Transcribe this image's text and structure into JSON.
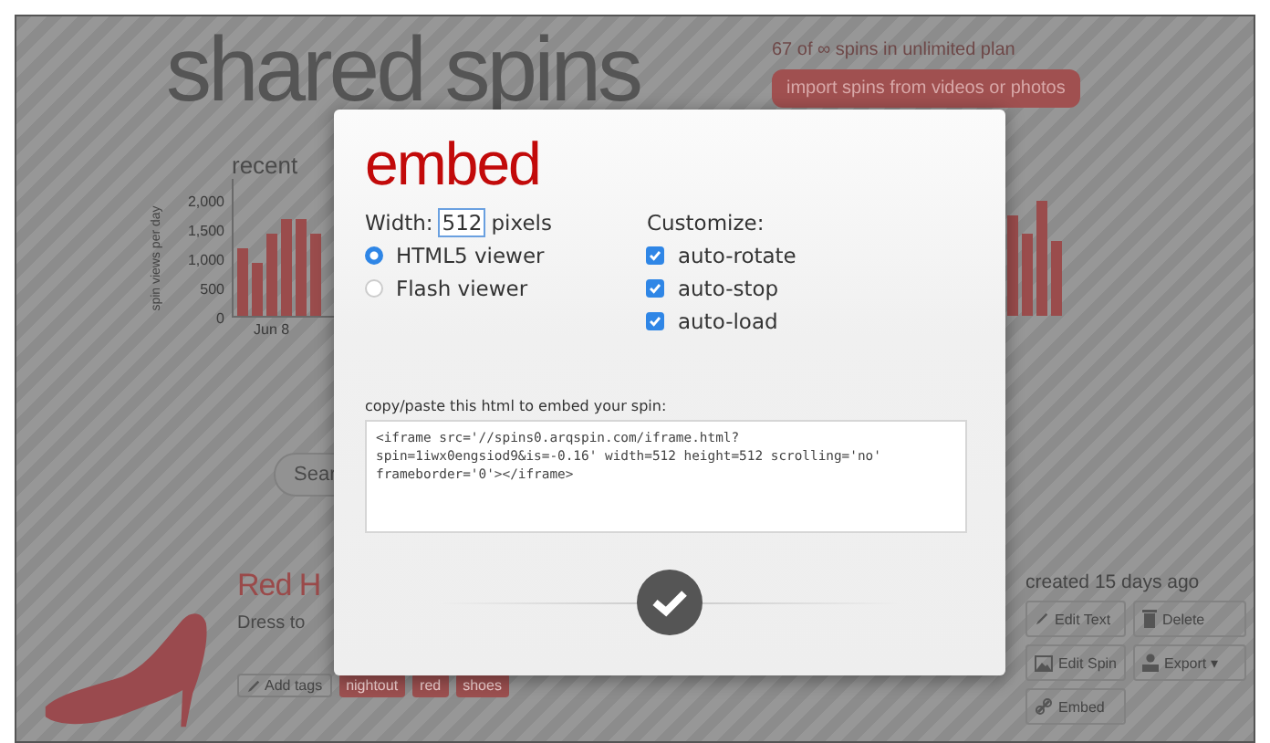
{
  "page": {
    "title": "shared spins",
    "plan_text": "67 of ∞ spins in unlimited plan",
    "import_button": "import spins from videos or photos",
    "chart": {
      "heading": "recent",
      "ylabel": "spin views per day",
      "yticks": [
        "2,000",
        "1,500",
        "1,000",
        "500",
        "0"
      ],
      "xtick": "Jun 8"
    },
    "search": {
      "placeholder": "Sear"
    },
    "spin": {
      "title": "Red H",
      "description": "Dress to",
      "tags": [
        {
          "label": "Add tags",
          "kind": "add"
        },
        {
          "label": "nightout",
          "kind": "tag"
        },
        {
          "label": "red",
          "kind": "tag"
        },
        {
          "label": "shoes",
          "kind": "tag"
        }
      ],
      "created": "created 15 days ago",
      "actions": [
        {
          "label": "Edit Text",
          "kind": "pencil"
        },
        {
          "label": "Delete",
          "kind": "trash"
        },
        {
          "label": "Edit Spin",
          "kind": "image"
        },
        {
          "label": "Export ▾",
          "kind": "person"
        },
        {
          "label": "Embed",
          "kind": "link"
        }
      ]
    }
  },
  "dialog": {
    "title": "embed",
    "width_label": "Width:",
    "width_value": "512",
    "width_unit": "pixels",
    "viewers": [
      {
        "label": "HTML5 viewer",
        "selected": true
      },
      {
        "label": "Flash viewer",
        "selected": false
      }
    ],
    "customize_label": "Customize:",
    "options": [
      {
        "label": "auto-rotate",
        "checked": true
      },
      {
        "label": "auto-stop",
        "checked": true
      },
      {
        "label": "auto-load",
        "checked": true
      }
    ],
    "code_label": "copy/paste this html to embed your spin:",
    "code": "<iframe src='//spins0.arqspin.com/iframe.html?spin=1iwx0engsiod9&is=-0.16' width=512 height=512 scrolling='no' frameborder='0'></iframe>"
  }
}
